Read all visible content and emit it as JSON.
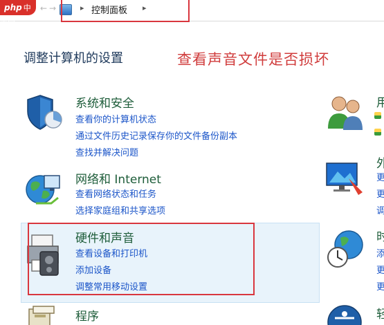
{
  "watermark": {
    "php": "php",
    "site": "中文网"
  },
  "addressbar": {
    "breadcrumb": "控制面板"
  },
  "page": {
    "title": "调整计算机的设置",
    "annotation": "查看声音文件是否损坏"
  },
  "categories": [
    {
      "title": "系统和安全",
      "links": [
        "查看你的计算机状态",
        "通过文件历史记录保存你的文件备份副本",
        "查找并解决问题"
      ]
    },
    {
      "title": "网络和 Internet",
      "links": [
        "查看网络状态和任务",
        "选择家庭组和共享选项"
      ]
    },
    {
      "title": "硬件和声音",
      "links": [
        "查看设备和打印机",
        "添加设备",
        "调整常用移动设置"
      ]
    },
    {
      "title": "程序",
      "links": []
    }
  ],
  "right_column": {
    "titles": [
      "用",
      "外",
      "时",
      "轻"
    ],
    "link_chars": [
      "更",
      "更",
      "调",
      "添",
      "更",
      "更"
    ]
  },
  "colors": {
    "accent_red": "#d9363e",
    "link_blue": "#1c56c9",
    "title_green": "#1e5d3a",
    "highlight": "#e8f3fb"
  }
}
